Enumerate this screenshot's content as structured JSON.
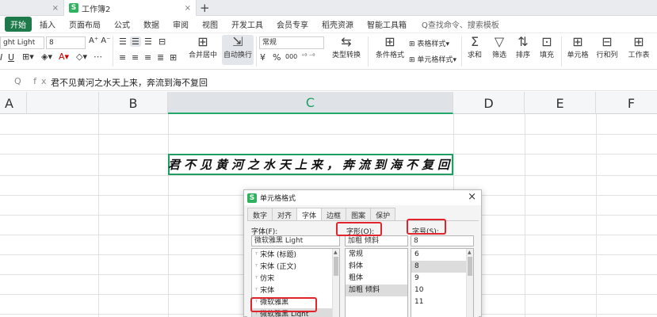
{
  "tabs": {
    "prev_close": "×",
    "active_title": "工作簿2",
    "active_close": "×",
    "new_tab": "+"
  },
  "menu": {
    "start": "开始",
    "items": [
      "插入",
      "页面布局",
      "公式",
      "数据",
      "审阅",
      "视图",
      "开发工具",
      "会员专享",
      "稻壳资源",
      "智能工具箱"
    ],
    "search": "Q查找命令、搜索模板"
  },
  "ribbon": {
    "font_name": "ght Light",
    "font_size": "8",
    "number_format": "常规",
    "merge_center": "合并居中",
    "wrap_text": "自动换行",
    "type_convert": "类型转换",
    "cond_format": "条件格式",
    "table_style": "表格样式",
    "cell_style": "单元格样式",
    "sum": "求和",
    "filter": "筛选",
    "sort": "排序",
    "fill": "填充",
    "cell": "单元格",
    "row_col": "行和列",
    "worksheet": "工作表",
    "currency": "¥",
    "percent": "%",
    "thousands": "000"
  },
  "formula_bar": {
    "icons": "Q fx",
    "content": "君不见黄河之水天上来，奔流到海不复回"
  },
  "grid": {
    "columns": [
      "A",
      "B",
      "C",
      "D",
      "E",
      "F"
    ],
    "selected_column": "C",
    "cell_text": "君不见黄河之水天上来，奔流到海不复回"
  },
  "dialog": {
    "title": "单元格格式",
    "close": "×",
    "tabs": [
      "数字",
      "对齐",
      "字体",
      "边框",
      "图案",
      "保护"
    ],
    "active_tab": "字体",
    "font_label": "字体(F):",
    "style_label": "字形(O):",
    "size_label": "字号(S):",
    "font_value": "微软雅黑 Light",
    "style_value": "加粗 倾斜",
    "size_value": "8",
    "font_list": [
      "宋体 (标题)",
      "宋体 (正文)",
      "仿宋",
      "宋体",
      "微软雅黑",
      "微软雅黑 Light"
    ],
    "style_list": [
      "常规",
      "斜体",
      "粗体",
      "加粗 倾斜"
    ],
    "size_list": [
      "6",
      "8",
      "9",
      "10",
      "11"
    ],
    "selected_style": "加粗 倾斜",
    "selected_size": "8",
    "highlight_color": "#e2242c"
  }
}
